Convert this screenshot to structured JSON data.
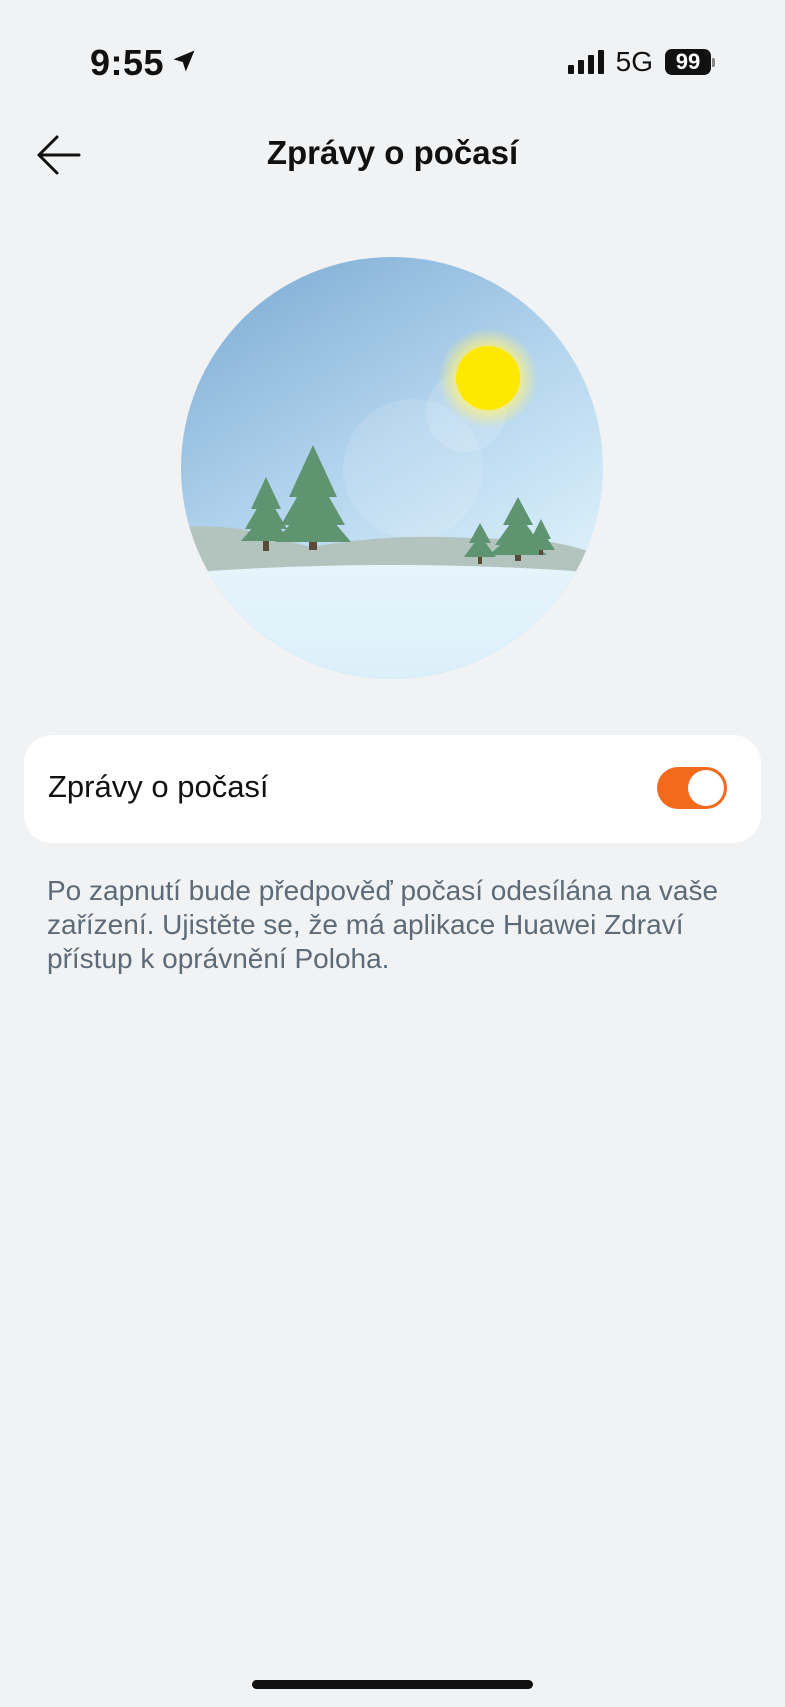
{
  "status_bar": {
    "time": "9:55",
    "network": "5G",
    "battery": "99",
    "location_icon": "location-arrow-icon",
    "signal_icon": "cellular-signal-icon"
  },
  "header": {
    "back_icon": "arrow-left-icon",
    "title": "Zprávy o počasí"
  },
  "illustration": {
    "scene": "winter-landscape-illustration",
    "icon": "sun-icon"
  },
  "setting": {
    "label": "Zprávy o počasí",
    "enabled": true,
    "accent_color": "#f26b1d"
  },
  "description": "Po zapnutí bude předpověď počasí odesílána na vaše zařízení. Ujistěte se, že má aplikace Huawei Zdraví přístup k oprávnění Poloha."
}
